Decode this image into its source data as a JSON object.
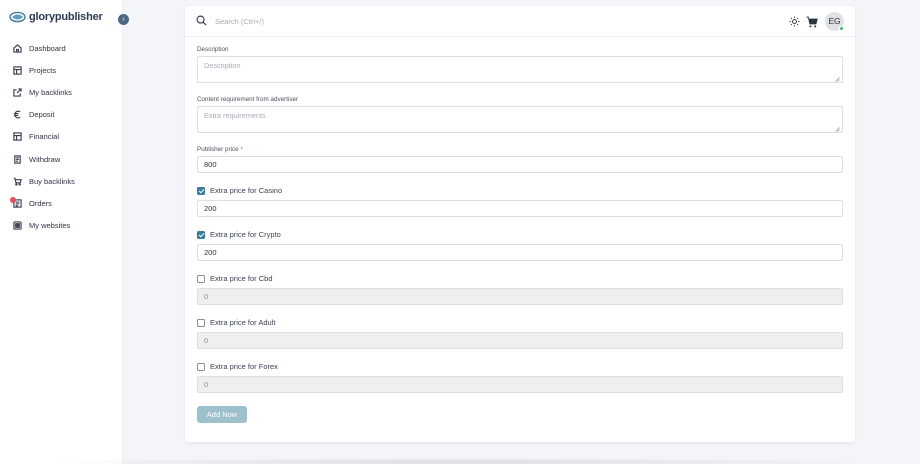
{
  "brand": {
    "name": "glorypublisher"
  },
  "sidebar": {
    "items": [
      {
        "label": "Dashboard",
        "icon": "home-icon"
      },
      {
        "label": "Projects",
        "icon": "layout-icon"
      },
      {
        "label": "My backlinks",
        "icon": "external-link-icon"
      },
      {
        "label": "Deposit",
        "icon": "euro-icon"
      },
      {
        "label": "Financial",
        "icon": "layout-icon"
      },
      {
        "label": "Withdraw",
        "icon": "receipt-icon"
      },
      {
        "label": "Buy backlinks",
        "icon": "cart-icon"
      },
      {
        "label": "Orders",
        "icon": "list-icon",
        "notification": true
      },
      {
        "label": "My websites",
        "icon": "grid-icon"
      }
    ]
  },
  "header": {
    "search_placeholder": "Search (Ctrl+/)",
    "avatar_initials": "EG"
  },
  "form": {
    "description": {
      "label": "Description",
      "placeholder": "Description"
    },
    "content_requirement": {
      "label": "Content requirement from advertiser",
      "placeholder": "Extra requirements"
    },
    "publisher_price": {
      "label": "Publisher price",
      "required_mark": "*",
      "value": "800"
    },
    "extras": [
      {
        "label": "Extra price for Casino",
        "checked": true,
        "value": "200"
      },
      {
        "label": "Extra price for Crypto",
        "checked": true,
        "value": "200"
      },
      {
        "label": "Extra price for Cbd",
        "checked": false,
        "value": "0"
      },
      {
        "label": "Extra price for Adult",
        "checked": false,
        "value": "0"
      },
      {
        "label": "Extra price for Forex",
        "checked": false,
        "value": "0"
      }
    ],
    "submit_label": "Add Now"
  },
  "colors": {
    "accent": "#3b7d98",
    "button": "#9cc0cc",
    "badge": "#e0505a"
  }
}
